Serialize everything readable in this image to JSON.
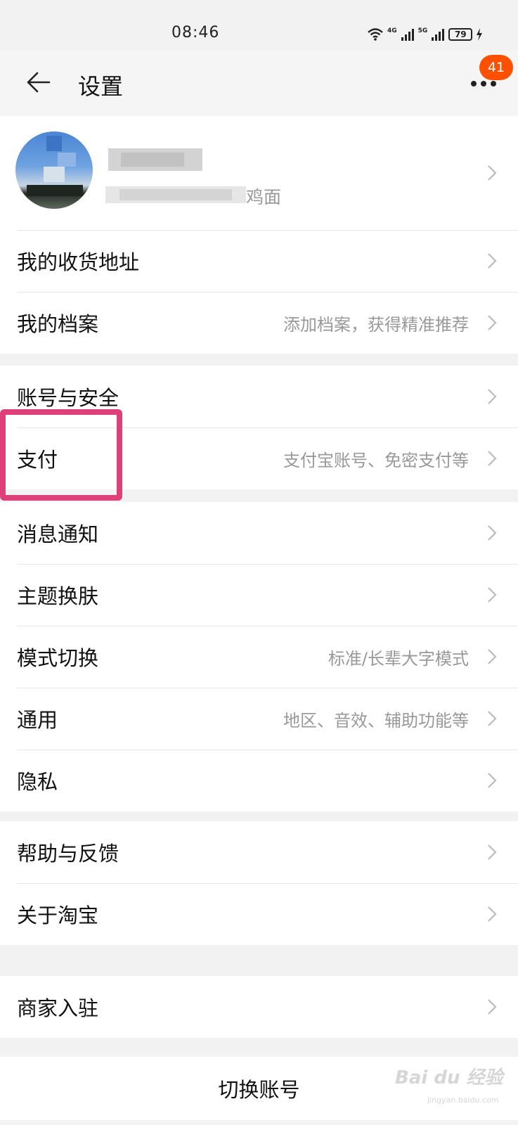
{
  "status_bar": {
    "time": "08:46",
    "net_1": "4G",
    "net_2": "5G",
    "battery": "79",
    "icons": [
      "wifi-icon",
      "signal-icon",
      "signal-icon",
      "battery-icon",
      "charging-icon"
    ]
  },
  "header": {
    "title": "设置",
    "badge_count": "41",
    "accent_color": "#ff5000"
  },
  "profile": {
    "suffix_text": "鸡面"
  },
  "groups": [
    {
      "rows": [
        {
          "label": "我的收货地址",
          "value": ""
        },
        {
          "label": "我的档案",
          "value": "添加档案，获得精准推荐"
        }
      ]
    },
    {
      "rows": [
        {
          "label": "账号与安全",
          "value": ""
        },
        {
          "label": "支付",
          "value": "支付宝账号、免密支付等"
        }
      ]
    },
    {
      "rows": [
        {
          "label": "消息通知",
          "value": ""
        },
        {
          "label": "主题换肤",
          "value": ""
        },
        {
          "label": "模式切换",
          "value": "标准/长辈大字模式"
        },
        {
          "label": "通用",
          "value": "地区、音效、辅助功能等"
        },
        {
          "label": "隐私",
          "value": ""
        }
      ]
    },
    {
      "rows": [
        {
          "label": "帮助与反馈",
          "value": ""
        },
        {
          "label": "关于淘宝",
          "value": ""
        }
      ]
    },
    {
      "rows": [
        {
          "label": "商家入驻",
          "value": ""
        }
      ]
    }
  ],
  "switch_account": "切换账号",
  "highlight_color": "#e0407a",
  "watermark": {
    "text": "Bai du 经验",
    "sub": "jingyan.baidu.com"
  }
}
